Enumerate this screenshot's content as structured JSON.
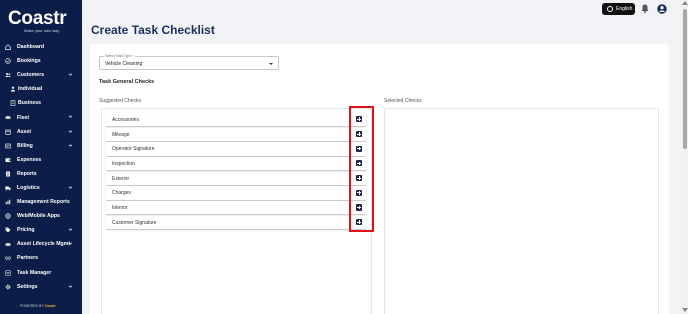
{
  "app": {
    "logo_text": "Coastr",
    "tagline": "Make your own way",
    "powered_by": "POWERED BY",
    "powered_brand": "Coastr"
  },
  "sidebar": {
    "items": [
      {
        "label": "Dashboard",
        "icon": "home-icon",
        "chevron": false,
        "sub": false
      },
      {
        "label": "Bookings",
        "icon": "check-circle-icon",
        "chevron": false,
        "sub": false
      },
      {
        "label": "Customers",
        "icon": "users-icon",
        "chevron": true,
        "sub": false
      },
      {
        "label": "Individual",
        "icon": "person-icon",
        "chevron": false,
        "sub": true
      },
      {
        "label": "Business",
        "icon": "building-icon",
        "chevron": false,
        "sub": true
      },
      {
        "label": "Fleet",
        "icon": "car-icon",
        "chevron": true,
        "sub": false
      },
      {
        "label": "Asset",
        "icon": "box-icon",
        "chevron": true,
        "sub": false
      },
      {
        "label": "Billing",
        "icon": "billing-icon",
        "chevron": true,
        "sub": false
      },
      {
        "label": "Expenses",
        "icon": "wallet-icon",
        "chevron": false,
        "sub": false
      },
      {
        "label": "Reports",
        "icon": "report-icon",
        "chevron": false,
        "sub": false
      },
      {
        "label": "Logistics",
        "icon": "truck-icon",
        "chevron": true,
        "sub": false
      },
      {
        "label": "Management Reports",
        "icon": "chart-icon",
        "chevron": false,
        "sub": false
      },
      {
        "label": "Web/Mobile Apps",
        "icon": "globe-icon",
        "chevron": false,
        "sub": false
      },
      {
        "label": "Pricing",
        "icon": "tag-icon",
        "chevron": true,
        "sub": false
      },
      {
        "label": "Asset Lifecycle Mgmt",
        "icon": "car-icon",
        "chevron": true,
        "sub": false
      },
      {
        "label": "Partners",
        "icon": "handshake-icon",
        "chevron": false,
        "sub": false
      },
      {
        "label": "Task Manager",
        "icon": "task-icon",
        "chevron": false,
        "sub": false
      },
      {
        "label": "Settings",
        "icon": "gear-icon",
        "chevron": true,
        "sub": false
      }
    ]
  },
  "header": {
    "language": "English",
    "icons": [
      "bell-icon",
      "avatar-icon"
    ]
  },
  "page": {
    "title": "Create Task Checklist",
    "task_type_label": "Select Task Type *",
    "task_type_value": "Vehicle Cleaning",
    "section_title": "Task General Checks",
    "suggested_label": "Suggested Checks",
    "selected_label": "Selected Checks",
    "suggested_checks": [
      "Accessories",
      "Mileage",
      "Operator Signature",
      "Inspection",
      "Exterior",
      "Charges",
      "Interior",
      "Customer Signature"
    ],
    "selected_checks": []
  },
  "colors": {
    "sidebar_bg": "#0b1d48",
    "title": "#1b2e5c",
    "add_button": "#1d2a4a",
    "highlight": "#e0111e"
  }
}
